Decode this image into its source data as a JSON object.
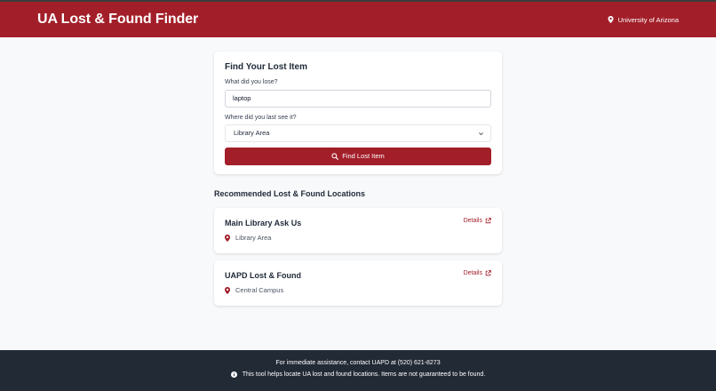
{
  "header": {
    "title": "UA Lost & Found Finder",
    "org_icon": "map-marker-icon",
    "org_label": "University of Arizona"
  },
  "search": {
    "title": "Find Your Lost Item",
    "item_label": "What did you lose?",
    "item_value": "laptop",
    "location_label": "Where did you last see it?",
    "location_value": "Library Area",
    "button_label": "Find Lost Item",
    "button_icon": "search-icon"
  },
  "results": {
    "title": "Recommended Lost & Found Locations",
    "details_label": "Details",
    "items": [
      {
        "name": "Main Library Ask Us",
        "area": "Library Area"
      },
      {
        "name": "UAPD Lost & Found",
        "area": "Central Campus"
      }
    ]
  },
  "footer": {
    "line1": "For immediate assistance, contact UAPD at (520) 621-8273",
    "line2": "This tool helps locate UA lost and found locations. Items are not guaranteed to be found."
  },
  "colors": {
    "brand": "#a21f29",
    "footer_bg": "#222a36",
    "page_bg": "#f8f9fb"
  }
}
